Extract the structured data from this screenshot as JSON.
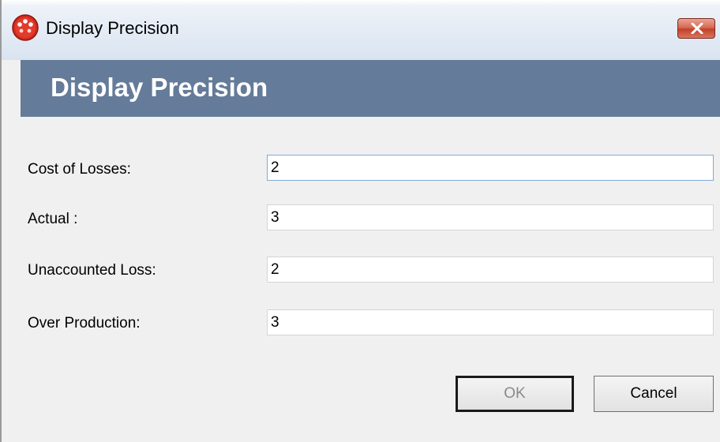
{
  "window": {
    "title": "Display Precision",
    "icon": "red-dots-app-icon",
    "close_icon": "close-x-icon"
  },
  "banner": {
    "title": "Display Precision"
  },
  "form": {
    "fields": [
      {
        "label": "Cost of Losses:",
        "value": "2"
      },
      {
        "label": "Actual :",
        "value": "3"
      },
      {
        "label": "Unaccounted Loss:",
        "value": "2"
      },
      {
        "label": "Over Production:",
        "value": "3"
      }
    ]
  },
  "buttons": {
    "ok_label": "OK",
    "cancel_label": "Cancel"
  },
  "colors": {
    "banner_background": "#647b99",
    "close_button": "#c2412a",
    "app_icon": "#d42a1e"
  }
}
